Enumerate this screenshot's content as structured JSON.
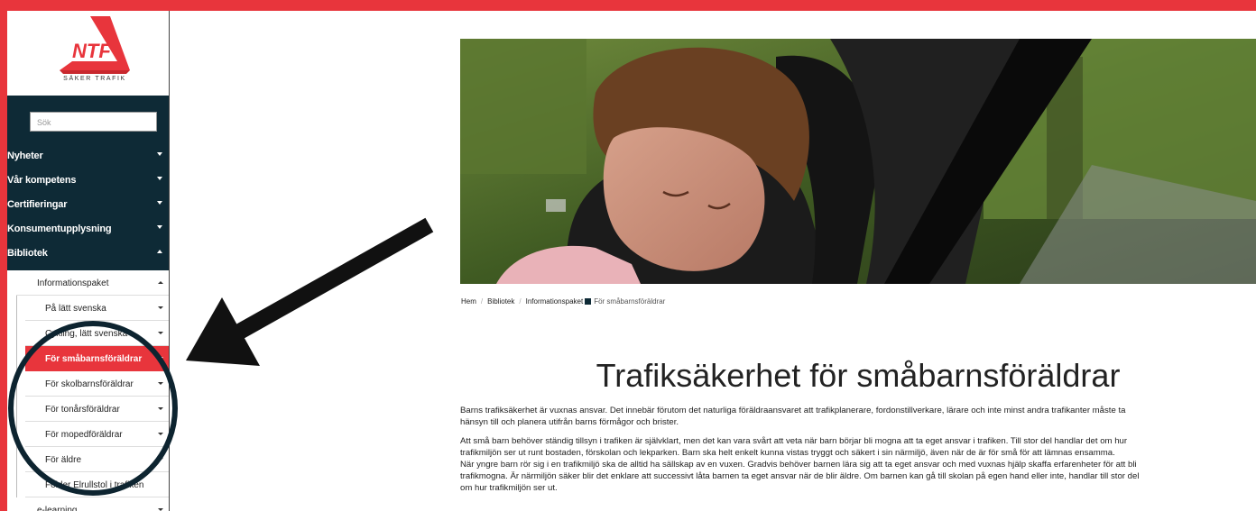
{
  "logo": {
    "mark": "NTF",
    "tagline": "SÄKER TRAFIK"
  },
  "search": {
    "placeholder": "Sök"
  },
  "nav": {
    "main": [
      "Nyheter",
      "Vår kompetens",
      "Certifieringar",
      "Konsumentupplysning",
      "Bibliotek"
    ],
    "sub": {
      "group": "Informationspaket",
      "items": [
        "På lätt svenska",
        "Cykling, lätt svenska",
        "För småbarnsföräldrar",
        "För skolbarnsföräldrar",
        "För tonårsföräldrar",
        "För mopedföräldrar",
        "För äldre",
        "Folder Elrullstol i trafiken"
      ],
      "next": "e-learning"
    }
  },
  "breadcrumb": [
    "Hem",
    "Bibliotek",
    "Informationspaket",
    "För småbarnsföräldrar"
  ],
  "article": {
    "title": "Trafiksäkerhet för småbarnsföräldrar",
    "p1": [
      "Barns trafiksäkerhet är vuxnas ansvar. Det innebär förutom det naturliga föräldraansvaret att trafikplanerare, fordonstillverkare, lärare och inte minst andra trafikanter måste ta",
      "hänsyn till och planera utifrån barns förmågor och brister."
    ],
    "p2": [
      "Att små barn behöver ständig tillsyn i trafiken är självklart, men det kan vara svårt att veta när barn börjar bli mogna att ta eget ansvar i trafiken. Till stor del handlar det om hur",
      "trafikmiljön ser ut runt bostaden, förskolan och lekparken. Barn ska helt enkelt kunna vistas tryggt och säkert i sin närmiljö, även när de är för små för att lämnas ensamma.",
      "När yngre barn rör sig i en trafikmiljö ska de alltid ha sällskap av en vuxen. Gradvis behöver barnen lära sig att ta eget ansvar och med vuxnas hjälp skaffa erfarenheter för att bli",
      "trafikmogna. Är närmiljön säker blir det enklare att successivt låta barnen ta eget ansvar när de blir äldre. Om barnen kan gå till skolan på egen hand eller inte, handlar till stor del",
      "om hur trafikmiljön ser ut."
    ]
  },
  "colors": {
    "brand_red": "#e8353c",
    "nav_dark": "#0e2a36"
  }
}
